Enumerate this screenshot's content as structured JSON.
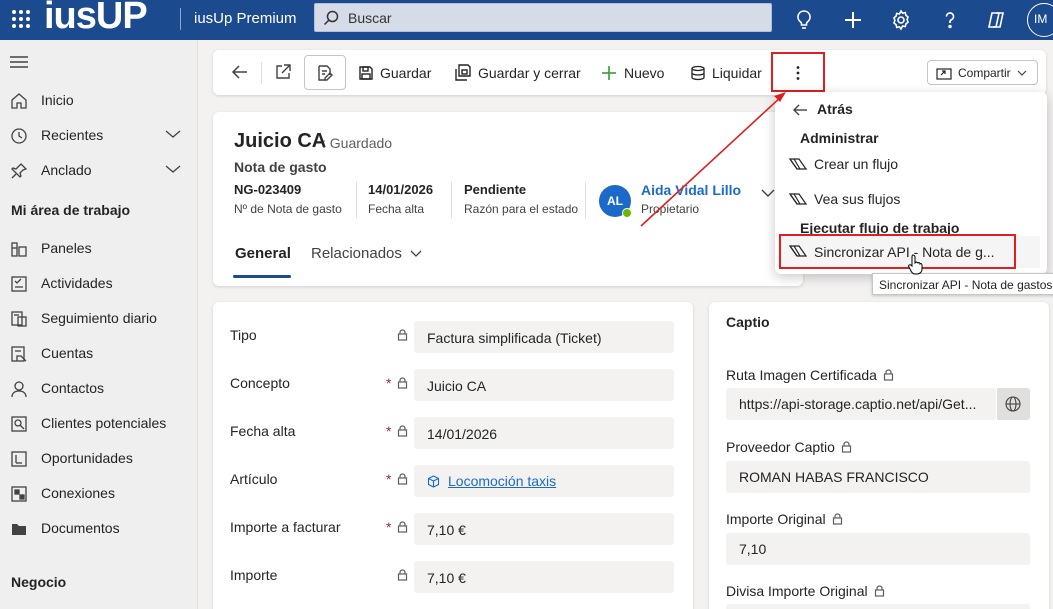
{
  "topbar": {
    "logo": "iusUP",
    "app_name": "iusUp Premium",
    "search_placeholder": "Buscar",
    "user_initials": "IM",
    "icons": [
      "waffle-icon",
      "lightbulb-icon",
      "plus-icon",
      "gear-icon",
      "help-icon",
      "copilot-icon"
    ]
  },
  "sidebar": {
    "items": [
      {
        "label": "Inicio",
        "icon": "home-icon"
      },
      {
        "label": "Recientes",
        "icon": "clock-icon",
        "expandable": true
      },
      {
        "label": "Anclado",
        "icon": "pin-icon",
        "expandable": true
      }
    ],
    "section_workarea": "Mi área de trabajo",
    "work_items": [
      {
        "label": "Paneles",
        "icon": "dashboard-icon"
      },
      {
        "label": "Actividades",
        "icon": "activity-icon"
      },
      {
        "label": "Seguimiento diario",
        "icon": "tracking-icon"
      },
      {
        "label": "Cuentas",
        "icon": "accounts-icon"
      },
      {
        "label": "Contactos",
        "icon": "contact-icon"
      },
      {
        "label": "Clientes potenciales",
        "icon": "leads-icon"
      },
      {
        "label": "Oportunidades",
        "icon": "opportunity-icon"
      },
      {
        "label": "Conexiones",
        "icon": "connections-icon"
      },
      {
        "label": "Documentos",
        "icon": "documents-icon"
      }
    ],
    "section_business": "Negocio"
  },
  "commandbar": {
    "save": "Guardar",
    "save_close": "Guardar y cerrar",
    "new": "Nuevo",
    "liquidar": "Liquidar",
    "share": "Compartir"
  },
  "record": {
    "title": "Juicio CA",
    "status_saved": ": Guardado",
    "entity": "Nota de gasto",
    "fields": [
      {
        "value": "NG-023409",
        "label": "Nº de Nota de gasto"
      },
      {
        "value": "14/01/2026",
        "label": "Fecha alta"
      },
      {
        "value": "Pendiente",
        "label": "Razón para el estado"
      }
    ],
    "owner": {
      "initials": "AL",
      "name": "Aida Vidal Lillo",
      "role": "Propietario"
    },
    "tabs": {
      "general": "General",
      "related": "Relacionados"
    }
  },
  "form": {
    "rows": [
      {
        "label": "Tipo",
        "required": false,
        "value": "Factura simplificada (Ticket)"
      },
      {
        "label": "Concepto",
        "required": true,
        "value": "Juicio CA"
      },
      {
        "label": "Fecha alta",
        "required": true,
        "value": "14/01/2026"
      },
      {
        "label": "Artículo",
        "required": true,
        "value": "Locomoción taxis"
      },
      {
        "label": "Importe a facturar",
        "required": true,
        "value": "7,10 €"
      },
      {
        "label": "Importe",
        "required": false,
        "value": "7,10 €"
      }
    ]
  },
  "captio": {
    "title": "Captio",
    "fields": [
      {
        "label": "Ruta Imagen Certificada",
        "value": "https://api-storage.captio.net/api/Get..."
      },
      {
        "label": "Proveedor Captio",
        "value": "ROMAN HABAS FRANCISCO"
      },
      {
        "label": "Importe Original",
        "value": "7,10"
      },
      {
        "label": "Divisa Importe Original",
        "value": ""
      }
    ]
  },
  "menu": {
    "back": "Atrás",
    "section_admin": "Administrar",
    "create_flow": "Crear un flujo",
    "view_flows": "Vea sus flujos",
    "section_run": "Ejecutar flujo de trabajo",
    "sync_item": "Sincronizar API - Nota de g...",
    "tooltip": "Sincronizar API - Nota de gastos -"
  },
  "colors": {
    "topbar": "#1c4a8f",
    "accent": "#1c6bc9",
    "annotation": "#e02020",
    "online": "#6bb700"
  }
}
